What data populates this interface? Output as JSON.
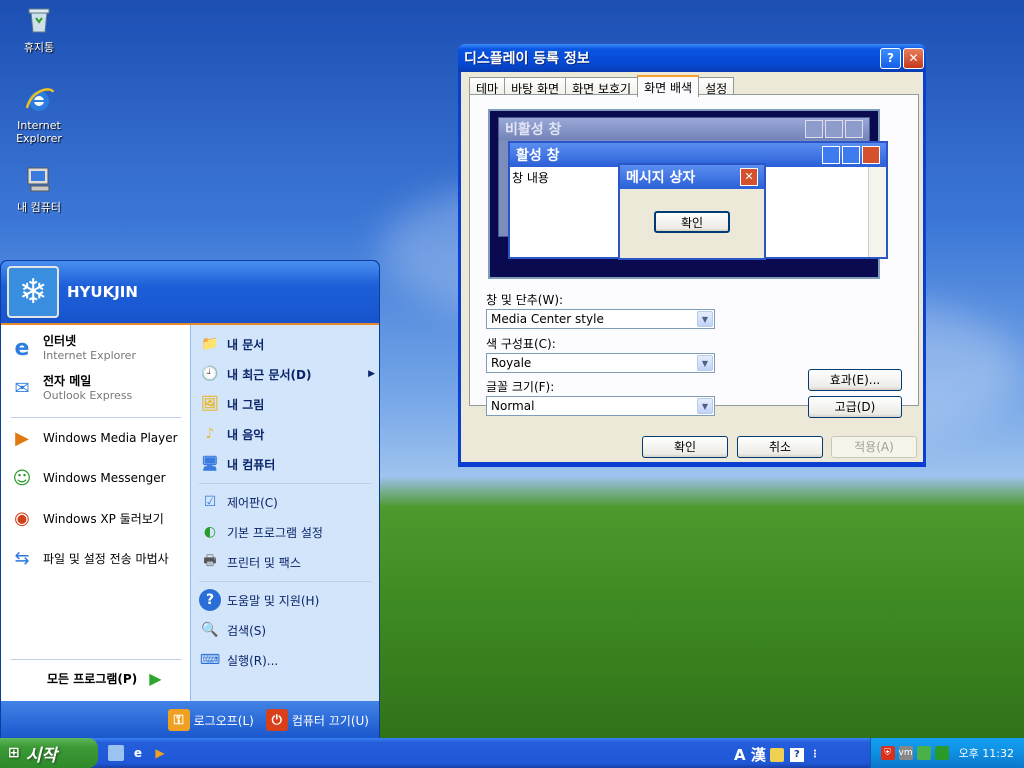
{
  "desktop": {
    "icons": [
      {
        "label": "휴지통",
        "icon": "recycle-bin-icon"
      },
      {
        "label": "Internet Explorer",
        "icon": "internet-explorer-icon"
      },
      {
        "label": "내 컴퓨터",
        "icon": "my-computer-icon"
      }
    ]
  },
  "dialog": {
    "title": "디스플레이 등록 정보",
    "tabs": [
      "테마",
      "바탕 화면",
      "화면 보호기",
      "화면 배색",
      "설정"
    ],
    "active_tab": "화면 배색",
    "preview": {
      "inactive_title": "비활성 창",
      "active_title": "활성 창",
      "window_text": "창 내용",
      "msgbox_title": "메시지 상자",
      "msgbox_ok": "확인"
    },
    "style_label": "창 및 단추(W):",
    "style_value": "Media Center style",
    "scheme_label": "색 구성표(C):",
    "scheme_value": "Royale",
    "font_label": "글꼴 크기(F):",
    "font_value": "Normal",
    "effects_button": "효과(E)...",
    "advanced_button": "고급(D)",
    "ok_button": "확인",
    "cancel_button": "취소",
    "apply_button": "적용(A)"
  },
  "start_menu": {
    "user": "HYUKJIN",
    "pinned": [
      {
        "title": "인터넷",
        "sub": "Internet Explorer"
      },
      {
        "title": "전자 메일",
        "sub": "Outlook Express"
      }
    ],
    "recent": [
      "Windows Media Player",
      "Windows Messenger",
      "Windows XP 둘러보기",
      "파일 및 설정 전송 마법사"
    ],
    "all_programs": "모든 프로그램(P)",
    "right_items": [
      "내 문서",
      "내 최근 문서(D)",
      "내 그림",
      "내 음악",
      "내 컴퓨터",
      "제어판(C)",
      "기본 프로그램 설정",
      "프린터 및 팩스",
      "도움말 및 지원(H)",
      "검색(S)",
      "실행(R)..."
    ],
    "logoff": "로그오프(L)",
    "shutdown": "컴퓨터 끄기(U)"
  },
  "taskbar": {
    "start_label": "시작",
    "lang_indicator": "A 漢",
    "clock": "오후 11:32"
  },
  "colors": {
    "xp_blue": "#0a3fd1",
    "start_green": "#3c9a36",
    "dialog_face": "#ece9d8"
  }
}
